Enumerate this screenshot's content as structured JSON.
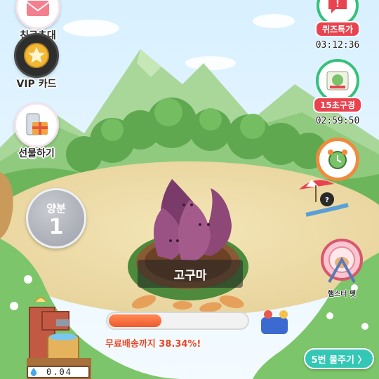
{
  "left_menu": {
    "invite": {
      "label": "친구초대",
      "icon": "envelope-icon"
    },
    "vip": {
      "label": "VIP 카드",
      "icon": "star-medal-icon"
    },
    "gift": {
      "label": "선물하기",
      "icon": "gift-phone-icon"
    }
  },
  "right_menu": {
    "quiz": {
      "label": "퀴즈특가",
      "timer": "03:12:36",
      "icon": "quiz-bubble-icon"
    },
    "fifteen": {
      "label": "15초구경",
      "timer": "02:59:50",
      "icon": "photo-frame-icon"
    },
    "alarm": {
      "icon": "alarm-clock-icon"
    },
    "beach": {
      "icon": "beach-chair-icon"
    },
    "hamster": {
      "label": "햄스터 펫",
      "icon": "hamster-wheel-icon"
    }
  },
  "nutrient": {
    "label": "양분",
    "value": "1"
  },
  "plant": {
    "name": "고구마"
  },
  "progress": {
    "value": 0.3834,
    "text": "무료배송까지 38.34%!"
  },
  "water_button": {
    "label": "5번 물주기 〉"
  },
  "water_counter": {
    "value": "0.04",
    "icon": "water-drop-icon"
  },
  "colors": {
    "progress_fill": "#ee5a2e",
    "water_button": "#35c7b5",
    "accent_red": "#e8434f"
  }
}
